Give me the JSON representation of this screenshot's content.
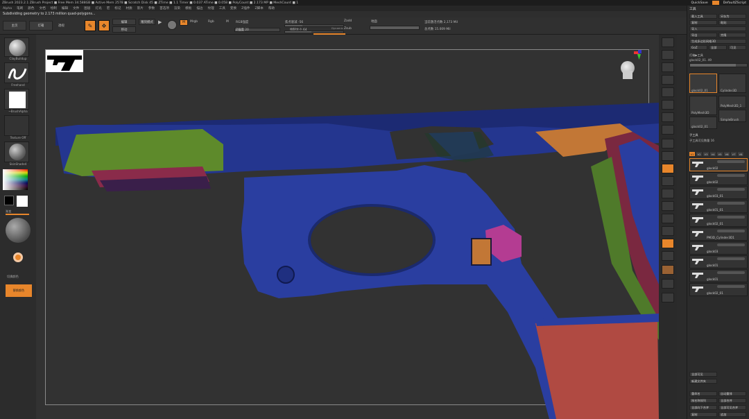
{
  "titlebar": {
    "text": "ZBrush 2023.2.1    ZBrush Project    ■ Free Mem 34.588GB ■ Active Mem 2578 ■ Scratch Disk 45 ■ ZTime ■ 1.1 Timer ■ 0.037 ATime ■ 0.058 ■ PolyCount ■ 2.173 MP ■ MeshCount ■ 1",
    "quicksave": "QuickSave",
    "script": "DefaultZScript"
  },
  "menu": [
    "Alpha",
    "笔刷",
    "颜色",
    "文档",
    "绘制",
    "编辑",
    "文件",
    "图层",
    "灯光",
    "宏",
    "标记",
    "材质",
    "影片",
    "参数",
    "首选项",
    "渲染",
    "模板",
    "描边",
    "纹理",
    "工具",
    "变换",
    "Z插件",
    "Z脚本",
    "帮助"
  ],
  "status": "Subdividing geometry to 2.173 million quad-polygons...",
  "toolbar": {
    "home": "主页",
    "lightbox": "灯箱",
    "edit_btn": "编辑",
    "move_btn": "移动",
    "sculpt_mode": "雕刻模式",
    "rgb_m": "Mrgb",
    "rgb": "Rgb",
    "m": "M",
    "rgb_intensity": "RGB强度",
    "z_add": "Zadd",
    "z_sub": "Zsub",
    "focal_shift_label": "焦点衰减",
    "focal_shift_value": "-56",
    "draw_size_label": "绘制大小",
    "draw_size_value": "64",
    "z_intensity_label": "Z强度",
    "z_intensity_value": "20",
    "dynamic": "Dynamic",
    "active_points_label": "当前激活点数",
    "active_points_value": "2,173 Mil",
    "total_points_label": "总点数",
    "total_points_value": "15.009 Mil",
    "perspective": "透视",
    "floor": "地面",
    "rgb_value": "100",
    "focal_fill": 0.3,
    "draw_fill": 0.45,
    "zint_fill": 0.2
  },
  "left": {
    "brush": "ClayBuildup",
    "stroke": "Freehand",
    "alpha": "~BrushAlpha",
    "texture": "Texture Off",
    "material": "SkinShade4",
    "gradient_label": "渐变",
    "switch_label": "切换颜色",
    "alt_label": "替换颜色"
  },
  "right": {
    "title": "工具",
    "load_tool": "载入工具",
    "save_as": "另存为",
    "copy": "复制",
    "paste": "粘贴",
    "import": "导入",
    "export": "导出",
    "clone": "克隆",
    "make_polymesh": "生成多边形网格3D",
    "goz": "GoZ",
    "all": "全部",
    "visible": "可见",
    "lightbox_tools": "灯箱▶工具",
    "current_tool": "glock02_01. 49",
    "tool_fill": 0.8,
    "tiles": [
      "glock02_01",
      "Cylinder3D",
      "PolyMesh3D",
      "PolyMesh3D_1",
      "SimpleBrush",
      "glock02_01"
    ],
    "subtool_header": "子工具",
    "subtool_count": "子工具可见数量 16",
    "subtools": [
      "glock02",
      "glock02",
      "glock03_01",
      "glock01_01",
      "glock02_01",
      "PM3D_Cylinder3D1",
      "glock03",
      "glock01",
      "glock01",
      "glock02_01"
    ],
    "v_tabs": [
      "V1",
      "V2",
      "V3",
      "V4",
      "V5",
      "V6",
      "V7",
      "V8"
    ],
    "bottom": [
      "全部可见",
      "新建文件夹",
      "重命名",
      "自动重排",
      "按名称排列",
      "全部合并",
      "全部向下合并",
      "全部可见合并",
      "复制",
      "追加"
    ]
  }
}
